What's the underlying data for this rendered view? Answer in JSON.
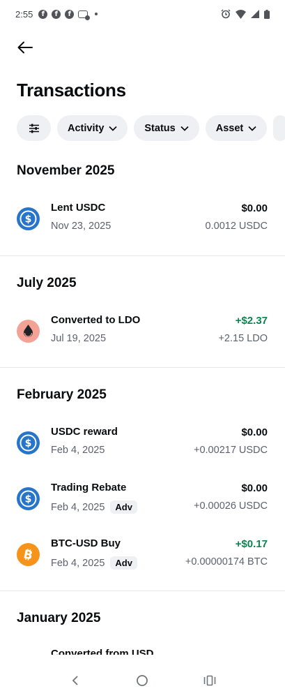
{
  "status_bar": {
    "time": "2:55",
    "notification_icons": [
      "facebook-icon",
      "facebook-icon",
      "facebook-icon",
      "messenger-icon"
    ],
    "right_icons": [
      "alarm-icon",
      "wifi-icon",
      "signal-icon",
      "battery-icon"
    ]
  },
  "header": {
    "title": "Transactions"
  },
  "filters": {
    "activity_label": "Activity",
    "status_label": "Status",
    "asset_label": "Asset"
  },
  "sections": [
    {
      "title": "November 2025",
      "items": [
        {
          "title": "Lent USDC",
          "date": "Nov 23, 2025",
          "amount": "$0.00",
          "sub": "0.0012 USDC",
          "icon": "usdc-icon",
          "positive": false
        }
      ]
    },
    {
      "title": "July 2025",
      "items": [
        {
          "title": "Converted to LDO",
          "date": "Jul 19, 2025",
          "amount": "+$2.37",
          "sub": "+2.15 LDO",
          "icon": "ldo-icon",
          "positive": true
        }
      ]
    },
    {
      "title": "February 2025",
      "items": [
        {
          "title": "USDC reward",
          "date": "Feb 4, 2025",
          "amount": "$0.00",
          "sub": "+0.00217 USDC",
          "icon": "usdc-icon",
          "positive": false
        },
        {
          "title": "Trading Rebate",
          "date": "Feb 4, 2025",
          "badge": "Adv",
          "amount": "$0.00",
          "sub": "+0.00026 USDC",
          "icon": "usdc-icon",
          "positive": false
        },
        {
          "title": "BTC-USD Buy",
          "date": "Feb 4, 2025",
          "badge": "Adv",
          "amount": "+$0.17",
          "sub": "+0.00000174 BTC",
          "icon": "btc-icon",
          "positive": true
        }
      ]
    },
    {
      "title": "January 2025",
      "items": [
        {
          "title": "Converted from USD"
        }
      ]
    }
  ],
  "colors": {
    "positive": "#098551",
    "usdc": "#2775ca",
    "ldo": "#f4a295",
    "btc": "#f7931a",
    "chip_bg": "#eef0f3"
  }
}
